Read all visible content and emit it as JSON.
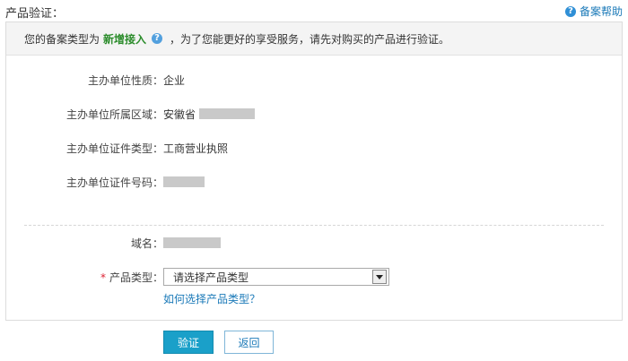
{
  "page": {
    "title": "产品验证：",
    "help_label": "备案帮助"
  },
  "notice": {
    "prefix": "您的备案类型为",
    "type": "新增接入",
    "suffix": "，为了您能更好的享受服务，请先对购买的产品进行验证。"
  },
  "fields": {
    "org_nature": {
      "label": "主办单位性质：",
      "value": "企业"
    },
    "org_region": {
      "label": "主办单位所属区域：",
      "value": "安徽省"
    },
    "cert_type": {
      "label": "主办单位证件类型：",
      "value": "工商营业执照"
    },
    "cert_number": {
      "label": "主办单位证件号码："
    },
    "domain": {
      "label": "域名："
    },
    "product_type": {
      "label": "产品类型：",
      "required_mark": "*",
      "selected": "请选择产品类型"
    }
  },
  "hint": {
    "link": "如何选择产品类型？"
  },
  "buttons": {
    "submit": "验证",
    "back": "返回"
  },
  "colors": {
    "accent": "#1aa0c9",
    "link": "#1a79b8",
    "highlight": "#2b8c2b",
    "required": "#dd2233"
  }
}
